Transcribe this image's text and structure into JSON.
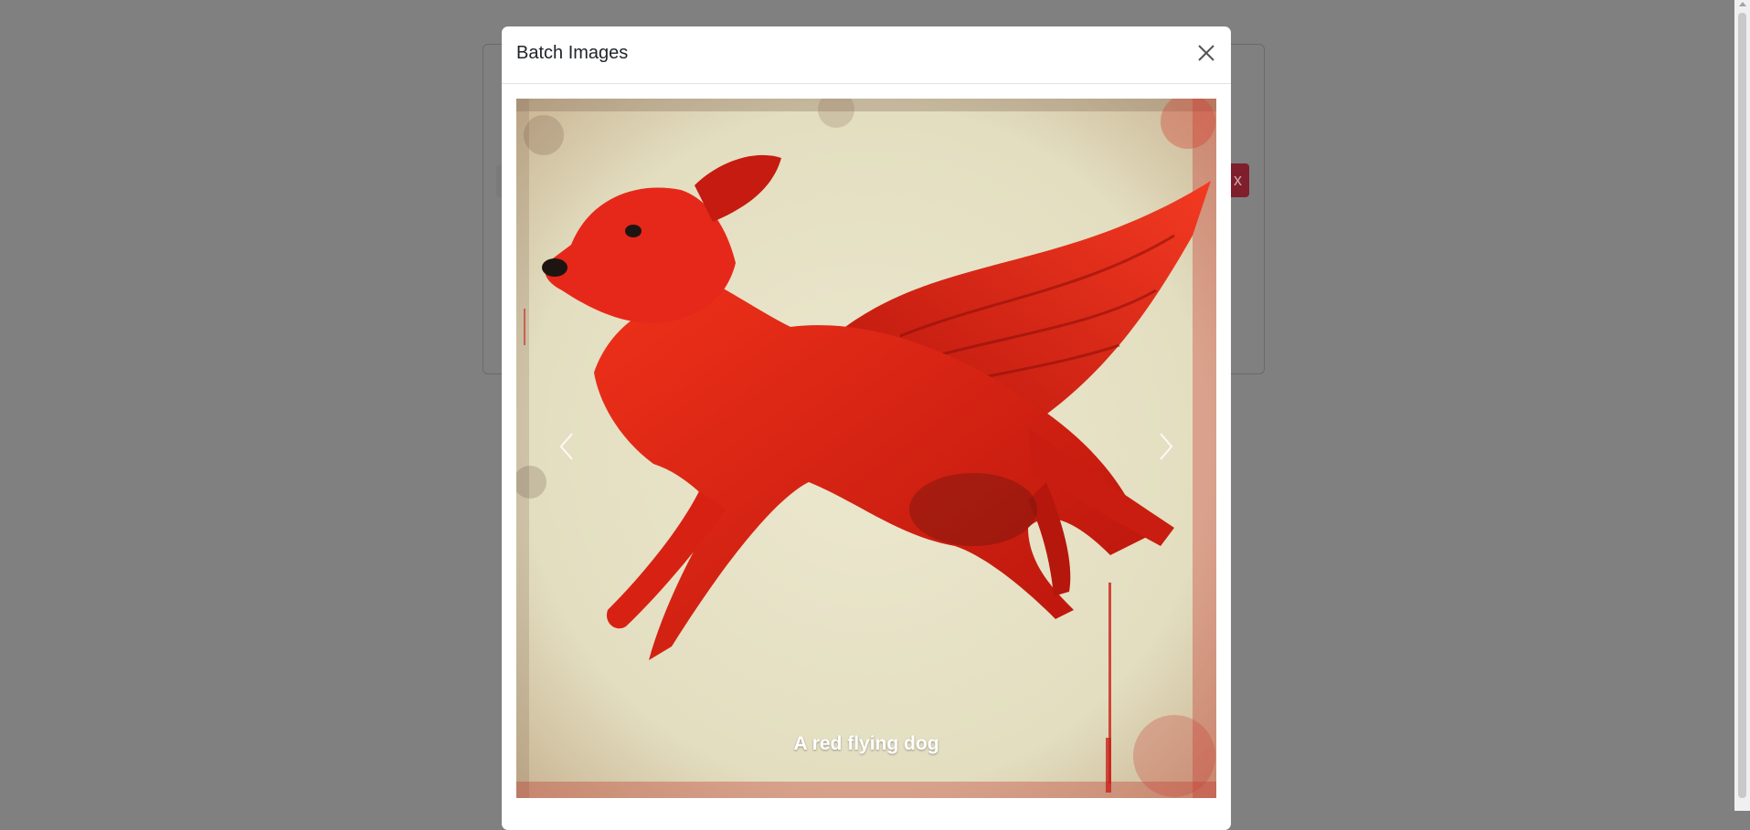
{
  "modal": {
    "title": "Batch Images",
    "close_icon": "close-icon"
  },
  "carousel": {
    "caption": "A red flying dog",
    "prev_icon": "chevron-left-icon",
    "next_icon": "chevron-right-icon"
  },
  "background": {
    "danger_button_label": "x"
  },
  "colors": {
    "backdrop": "#808080",
    "dog_red": "#e0200f",
    "paper": "#e8e4c8",
    "danger": "#dc3545"
  }
}
